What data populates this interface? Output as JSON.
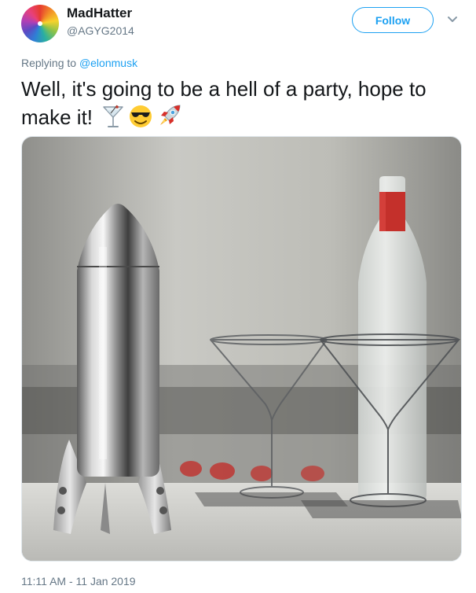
{
  "tweet": {
    "author": {
      "display_name": "MadHatter",
      "handle": "@AGYG2014",
      "avatar_icon": "rainbow-swirl-avatar"
    },
    "follow_label": "Follow",
    "menu_icon": "chevron-down-icon",
    "reply": {
      "prefix": "Replying to ",
      "mention": "@elonmusk"
    },
    "text": "Well, it's going to be a hell of a party, hope to make it!",
    "emojis": [
      "cocktail-glass-icon",
      "smiling-face-with-sunglasses-icon",
      "rocket-icon"
    ],
    "media": {
      "type": "photo",
      "subject": "rocket-cocktail-shaker-with-martini-glasses-and-bottle"
    },
    "timestamp": "11:11 AM - 11 Jan 2019"
  },
  "colors": {
    "accent": "#1da1f2",
    "secondary_text": "#657786",
    "primary_text": "#14171a"
  }
}
